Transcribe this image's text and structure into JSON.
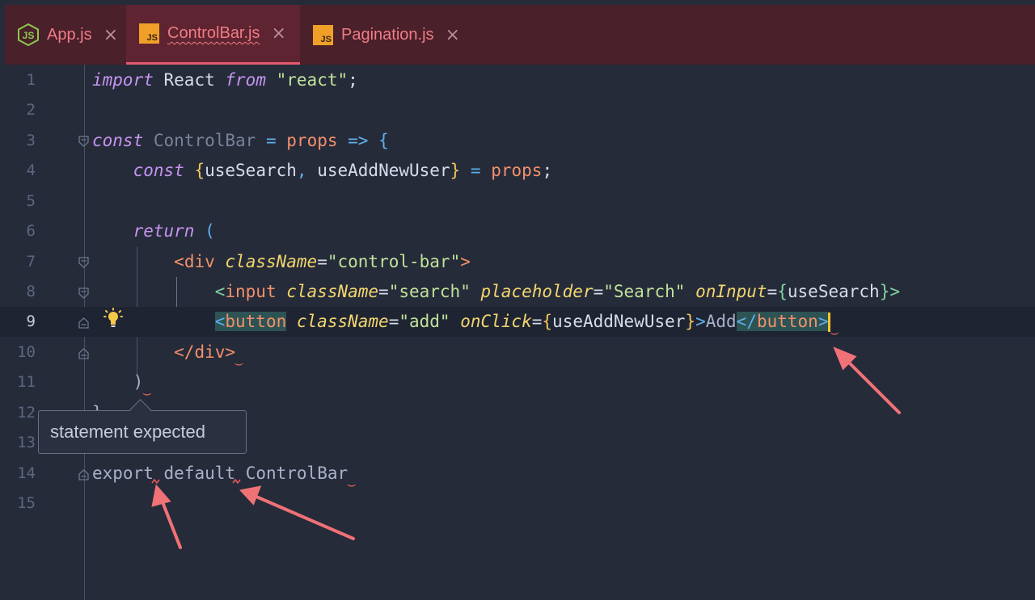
{
  "tabs": [
    {
      "name": "App.js",
      "icon": "nodejs-icon",
      "active": false
    },
    {
      "name": "ControlBar.js",
      "icon": "js-file-icon",
      "active": true
    },
    {
      "name": "Pagination.js",
      "icon": "js-file-icon",
      "active": false
    }
  ],
  "close_glyph": "×",
  "js_icon_text": "JS",
  "lines": {
    "l1": {
      "num": "1",
      "import": "import",
      "name": "React",
      "from": "from",
      "module": "\"react\"",
      "semi": ";"
    },
    "l2": {
      "num": "2"
    },
    "l3": {
      "num": "3",
      "const": "const",
      "name": "ControlBar",
      "eq": "=",
      "param": "props",
      "arrow": "=>",
      "open": "{"
    },
    "l4": {
      "num": "4",
      "const": "const",
      "open": "{",
      "a": "useSearch",
      "comma": ",",
      "b": "useAddNewUser",
      "close": "}",
      "eq": "=",
      "props": "props",
      "semi": ";"
    },
    "l5": {
      "num": "5"
    },
    "l6": {
      "num": "6",
      "ret": "return",
      "paren": "("
    },
    "l7": {
      "num": "7",
      "open": "<",
      "tag": "div",
      "attr": "className",
      "eq": "=",
      "val": "\"control-bar\"",
      "close": ">"
    },
    "l8": {
      "num": "8",
      "open": "<",
      "tag": "input",
      "attr1": "className",
      "eq1": "=",
      "val1": "\"search\"",
      "attr2": "placeholder",
      "eq2": "=",
      "val2": "\"Search\"",
      "attr3": "onInput",
      "eq3": "=",
      "bo": "{",
      "expr": "useSearch",
      "bc": "}",
      "close": ">"
    },
    "l9": {
      "num": "9",
      "open": "<",
      "tag": "button",
      "attr1": "className",
      "eq1": "=",
      "val1": "\"add\"",
      "attr2": "onClick",
      "eq2": "=",
      "bo": "{",
      "expr": "useAddNewUser",
      "bc": "}",
      "gt": ">",
      "text": "Add",
      "endopen": "</",
      "endtag": "button",
      "endclose": ">"
    },
    "l10": {
      "num": "10",
      "code": "</div>"
    },
    "l11": {
      "num": "11",
      "code": ")"
    },
    "l12": {
      "num": "12",
      "code": "}"
    },
    "l13": {
      "num": "13"
    },
    "l14": {
      "num": "14",
      "export": "export",
      "default": "default",
      "name": "ControlBar"
    },
    "l15": {
      "num": "15"
    }
  },
  "tooltip": {
    "text": "statement expected"
  },
  "colors": {
    "background": "#262b3a",
    "tabbar": "#4a202a",
    "active_tab_underline": "#e65a70",
    "error_squiggle": "#ef5a5a",
    "annotation_arrow": "#f07276",
    "caret": "#f3c530"
  }
}
